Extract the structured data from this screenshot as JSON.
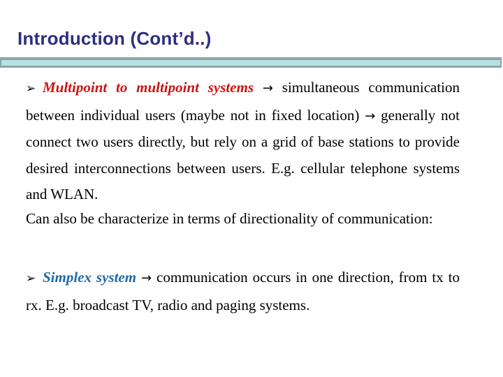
{
  "slide": {
    "title": "Introduction (Cont’d..)",
    "title_color": "#2e2e80",
    "bar_colors": {
      "border": "#8fa5a5",
      "fill": "#b8e1e5"
    }
  },
  "icons": {
    "bullet": "➢",
    "arrow": "→"
  },
  "paragraphs": [
    {
      "bullet": true,
      "keyword": "Multipoint to multipoint systems",
      "keyword_color": "#cc1414",
      "text_1": " simultaneous communication between individual users (maybe not in fixed location) ",
      "text_2": " generally not connect two users directly, but rely on a grid of base stations to provide desired interconnections between users. E.g. cellular telephone systems and WLAN."
    },
    {
      "bullet": false,
      "text": "Can also be characterize in terms of directionality of communication:"
    },
    {
      "bullet": true,
      "keyword": "Simplex system",
      "keyword_color": "#1f6aa5",
      "text_1": " communication occurs in one direction, from tx to rx. E.g. broadcast TV, radio and paging systems."
    }
  ]
}
